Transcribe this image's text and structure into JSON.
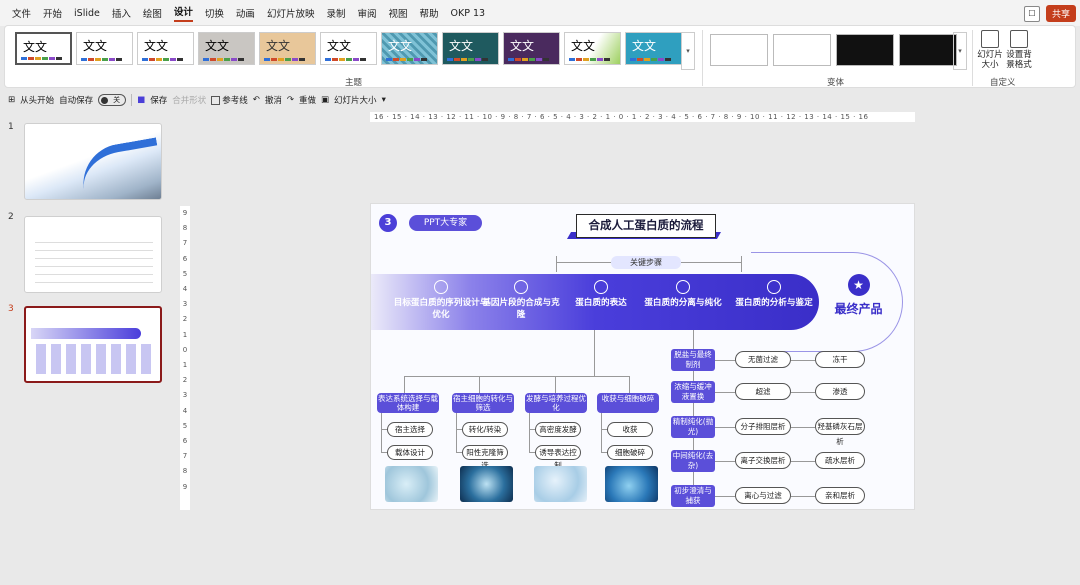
{
  "menu": [
    "文件",
    "开始",
    "iSlide",
    "插入",
    "绘图",
    "设计",
    "切换",
    "动画",
    "幻灯片放映",
    "录制",
    "审阅",
    "视图",
    "帮助",
    "OKP 13"
  ],
  "share_label": "共享",
  "ribbon": {
    "theme_sample": "文文",
    "group_themes": "主题",
    "group_variants": "变体",
    "group_custom": "自定义",
    "slide_size_label": "幻灯片大小",
    "format_bg_label": "设置背景格式"
  },
  "qat": {
    "from_start": "从头开始",
    "autosave": "自动保存",
    "autosave_state": "关",
    "save": "保存",
    "merge_shapes": "合并形状",
    "guides": "参考线",
    "undo": "撤消",
    "redo": "重做",
    "slide_size": "幻灯片大小"
  },
  "slides": [
    "1",
    "2",
    "3"
  ],
  "ruler_h": "16 · 15 · 14 · 13 · 12 · 11 · 10 · 9 · 8 · 7 · 6 · 5 · 4 · 3 · 2 · 1 · 0 · 1 · 2 · 3 · 4 · 5 · 6 · 7 · 8 · 9 · 10 · 11 · 12 · 13 · 14 · 15 · 16",
  "ruler_v": [
    "9",
    "8",
    "7",
    "6",
    "5",
    "4",
    "3",
    "2",
    "1",
    "0",
    "1",
    "2",
    "3",
    "4",
    "5",
    "6",
    "7",
    "8",
    "9"
  ],
  "slide": {
    "number": "3",
    "pill": "PPT大专家",
    "title": "合成人工蛋白质的流程",
    "key_steps": "关键步骤",
    "steps": [
      "目标蛋白质的序列设计与优化",
      "基因片段的合成与克隆",
      "蛋白质的表达",
      "蛋白质的分离与纯化",
      "蛋白质的分析与鉴定"
    ],
    "final": "最终产品",
    "categories": [
      {
        "label": "表达系统选择与载体构建",
        "subs": [
          "宿主选择",
          "载体设计"
        ]
      },
      {
        "label": "宿主细胞的转化与筛选",
        "subs": [
          "转化/转染",
          "阳性克隆筛选"
        ]
      },
      {
        "label": "发酵与培养过程优化",
        "subs": [
          "高密度发酵",
          "诱导表达控制"
        ]
      },
      {
        "label": "收获与细胞破碎",
        "subs": [
          "收获",
          "细胞破碎"
        ]
      }
    ],
    "purification": [
      {
        "label": "脱盐与最终制剂",
        "methods": [
          "无菌过滤",
          "冻干"
        ]
      },
      {
        "label": "浓缩与缓冲液置换",
        "methods": [
          "超滤",
          "渗透"
        ]
      },
      {
        "label": "精制纯化(抛光)",
        "methods": [
          "分子排阻层析",
          "羟基磷灰石层析"
        ]
      },
      {
        "label": "中间纯化(去杂)",
        "methods": [
          "离子交换层析",
          "疏水层析"
        ]
      },
      {
        "label": "初步澄清与捕获",
        "methods": [
          "离心与过滤",
          "亲和层析"
        ]
      }
    ]
  }
}
